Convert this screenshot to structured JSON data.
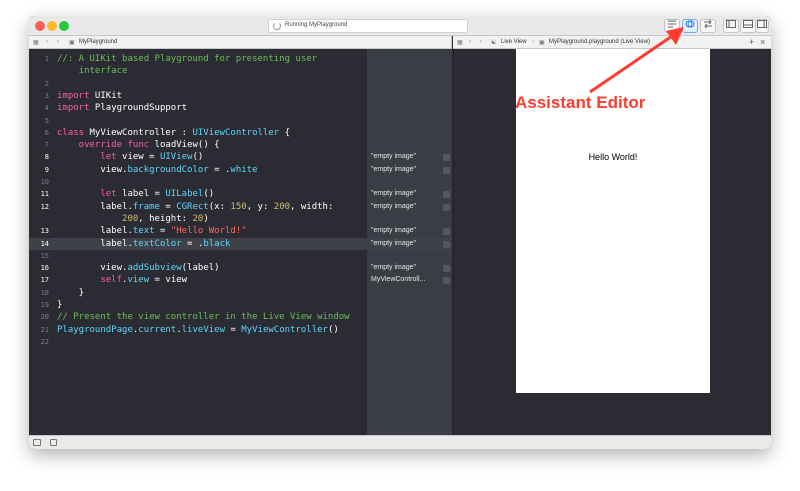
{
  "window": {
    "status_text": "Running MyPlayground"
  },
  "jumpbar_left": {
    "file_name": "MyPlayground"
  },
  "jumpbar_right": {
    "live_view_label": "Live View",
    "file_name": "MyPlayground.playground (Live View)",
    "add_glyph": "+",
    "close_glyph": "×"
  },
  "code_lines": [
    {
      "n": "1",
      "segments": [
        {
          "t": "//: A UIKit based Playground for presenting user",
          "c": "cm"
        }
      ]
    },
    {
      "n": "",
      "segments": [
        {
          "t": "    interface",
          "c": "cm"
        }
      ]
    },
    {
      "n": "2",
      "segments": []
    },
    {
      "n": "3",
      "segments": [
        {
          "t": "import",
          "c": "kw"
        },
        {
          "t": " UIKit",
          "c": "pl"
        }
      ]
    },
    {
      "n": "4",
      "segments": [
        {
          "t": "import",
          "c": "kw"
        },
        {
          "t": " PlaygroundSupport",
          "c": "pl"
        }
      ]
    },
    {
      "n": "5",
      "segments": []
    },
    {
      "n": "6",
      "segments": [
        {
          "t": "class",
          "c": "kw"
        },
        {
          "t": " MyViewController : ",
          "c": "pl"
        },
        {
          "t": "UIViewController",
          "c": "ty"
        },
        {
          "t": " {",
          "c": "pl"
        }
      ]
    },
    {
      "n": "7",
      "segments": [
        {
          "t": "    override",
          "c": "kw"
        },
        {
          "t": " ",
          "c": "pl"
        },
        {
          "t": "func",
          "c": "kw"
        },
        {
          "t": " loadView() {",
          "c": "pl"
        }
      ]
    },
    {
      "n": "8",
      "segments": [
        {
          "t": "        let",
          "c": "kw"
        },
        {
          "t": " view = ",
          "c": "pl"
        },
        {
          "t": "UIView",
          "c": "ty"
        },
        {
          "t": "()",
          "c": "pl"
        }
      ]
    },
    {
      "n": "9",
      "segments": [
        {
          "t": "        view.",
          "c": "pl"
        },
        {
          "t": "backgroundColor",
          "c": "ty"
        },
        {
          "t": " = .",
          "c": "pl"
        },
        {
          "t": "white",
          "c": "ty"
        }
      ]
    },
    {
      "n": "10",
      "segments": []
    },
    {
      "n": "11",
      "segments": [
        {
          "t": "        let",
          "c": "kw"
        },
        {
          "t": " label = ",
          "c": "pl"
        },
        {
          "t": "UILabel",
          "c": "ty"
        },
        {
          "t": "()",
          "c": "pl"
        }
      ]
    },
    {
      "n": "12",
      "segments": [
        {
          "t": "        label.",
          "c": "pl"
        },
        {
          "t": "frame",
          "c": "ty"
        },
        {
          "t": " = ",
          "c": "pl"
        },
        {
          "t": "CGRect",
          "c": "ty"
        },
        {
          "t": "(x: ",
          "c": "pl"
        },
        {
          "t": "150",
          "c": "nm"
        },
        {
          "t": ", y: ",
          "c": "pl"
        },
        {
          "t": "200",
          "c": "nm"
        },
        {
          "t": ", width:",
          "c": "pl"
        }
      ]
    },
    {
      "n": "",
      "segments": [
        {
          "t": "            ",
          "c": "pl"
        },
        {
          "t": "200",
          "c": "nm"
        },
        {
          "t": ", height: ",
          "c": "pl"
        },
        {
          "t": "20",
          "c": "nm"
        },
        {
          "t": ")",
          "c": "pl"
        }
      ]
    },
    {
      "n": "13",
      "segments": [
        {
          "t": "        label.",
          "c": "pl"
        },
        {
          "t": "text",
          "c": "ty"
        },
        {
          "t": " = ",
          "c": "pl"
        },
        {
          "t": "\"Hello World!\"",
          "c": "st"
        }
      ]
    },
    {
      "n": "14",
      "segments": [
        {
          "t": "        label.",
          "c": "pl"
        },
        {
          "t": "textColor",
          "c": "ty"
        },
        {
          "t": " = .",
          "c": "pl"
        },
        {
          "t": "black",
          "c": "ty"
        }
      ],
      "highlight": true
    },
    {
      "n": "15",
      "segments": []
    },
    {
      "n": "16",
      "segments": [
        {
          "t": "        view.",
          "c": "pl"
        },
        {
          "t": "addSubview",
          "c": "ty"
        },
        {
          "t": "(label)",
          "c": "pl"
        }
      ]
    },
    {
      "n": "17",
      "segments": [
        {
          "t": "        self",
          "c": "kw"
        },
        {
          "t": ".",
          "c": "pl"
        },
        {
          "t": "view",
          "c": "ty"
        },
        {
          "t": " = view",
          "c": "pl"
        }
      ]
    },
    {
      "n": "18",
      "segments": [
        {
          "t": "    }",
          "c": "pl"
        }
      ]
    },
    {
      "n": "19",
      "segments": [
        {
          "t": "}",
          "c": "pl"
        }
      ]
    },
    {
      "n": "20",
      "segments": [
        {
          "t": "// Present the view controller in the Live View window",
          "c": "cm"
        }
      ]
    },
    {
      "n": "21",
      "segments": [
        {
          "t": "PlaygroundPage",
          "c": "ty"
        },
        {
          "t": ".",
          "c": "pl"
        },
        {
          "t": "current",
          "c": "ty"
        },
        {
          "t": ".",
          "c": "pl"
        },
        {
          "t": "liveView",
          "c": "ty"
        },
        {
          "t": " = ",
          "c": "pl"
        },
        {
          "t": "MyViewController",
          "c": "ty"
        },
        {
          "t": "()",
          "c": "pl"
        }
      ]
    },
    {
      "n": "22",
      "segments": []
    }
  ],
  "results": [
    {
      "row": 8,
      "text": "\"empty image\""
    },
    {
      "row": 9,
      "text": "\"empty image\""
    },
    {
      "row": 11,
      "text": "\"empty image\""
    },
    {
      "row": 12,
      "text": "\"empty image\""
    },
    {
      "row": 14,
      "text": "\"empty image\""
    },
    {
      "row": 15,
      "text": "\"empty image\""
    },
    {
      "row": 17,
      "text": "\"empty image\""
    },
    {
      "row": 18,
      "text": "MyViewControll..."
    }
  ],
  "live_view": {
    "label_text": "Hello World!"
  },
  "annotation": {
    "text": "Assistant Editor",
    "color": "#ff3b30"
  },
  "colors": {
    "editor_bg": "#2b2b33",
    "keyword": "#fc5fa3",
    "type": "#5dd8ff",
    "comment": "#6bbf59",
    "string": "#fc6a5d",
    "number": "#d0bf69"
  }
}
